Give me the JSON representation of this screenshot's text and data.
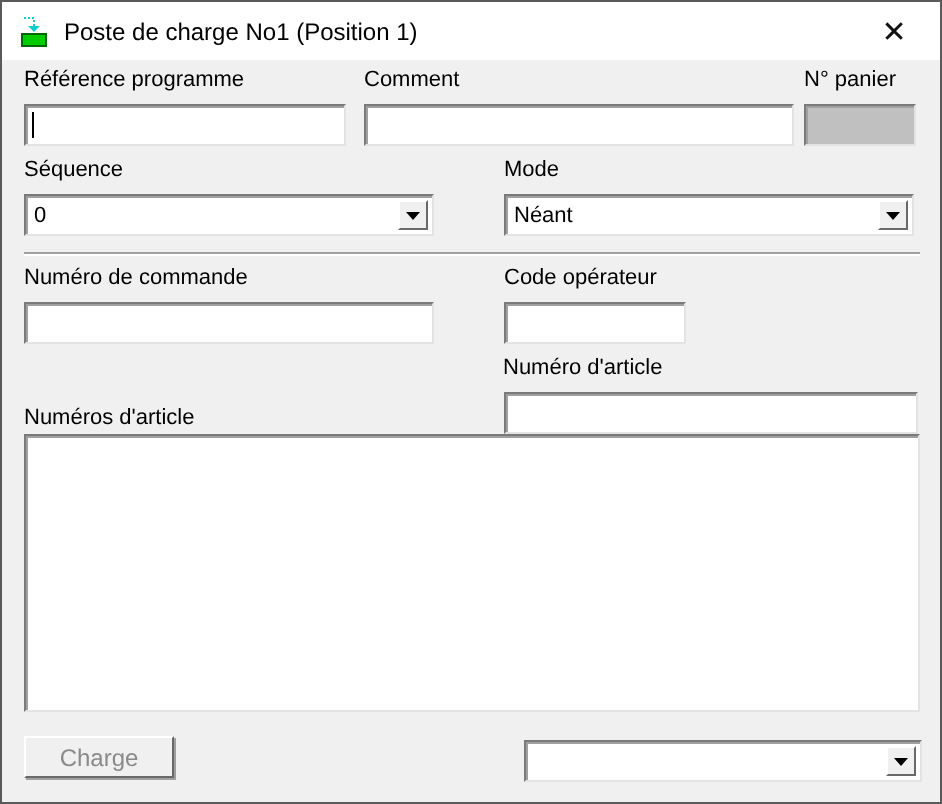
{
  "window": {
    "title": "Poste de charge No1 (Position 1)",
    "close": "✕"
  },
  "program_reference": {
    "label": "Référence programme",
    "focused": true
  },
  "comment": {
    "label": "Comment"
  },
  "basket_number": {
    "label": "N° panier",
    "disabled": true
  },
  "sequence": {
    "label": "Séquence",
    "value": "0"
  },
  "mode": {
    "label": "Mode",
    "value": "Néant"
  },
  "order_number": {
    "label": "Numéro de commande"
  },
  "operator_code": {
    "label": "Code opérateur"
  },
  "article_number": {
    "label": "Numéro d'article"
  },
  "article_numbers": {
    "label": "Numéros d'article"
  },
  "charge_button": {
    "label": "Charge",
    "disabled": true
  }
}
